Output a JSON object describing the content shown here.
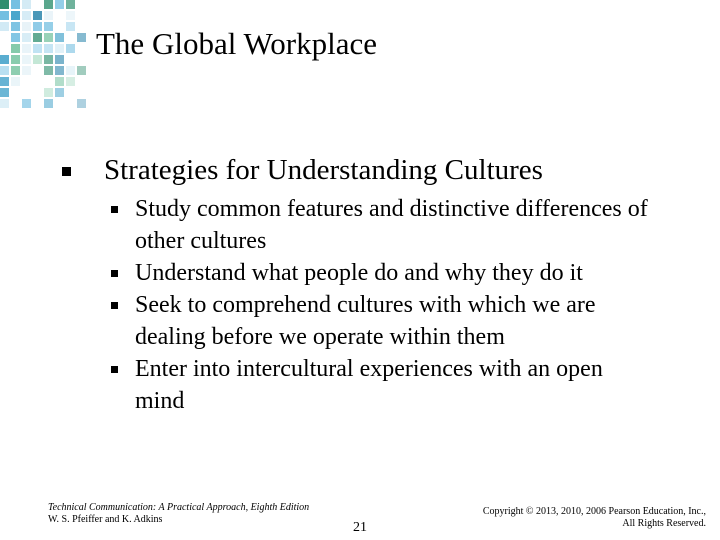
{
  "slide": {
    "title": "The Global Workplace",
    "main_bullet": "Strategies for Understanding Cultures",
    "sub_bullets": [
      "Study common features and distinctive differences of other cultures",
      "Understand what people do and why they do it",
      "Seek to comprehend cultures with which we are dealing before we operate within them",
      "Enter into intercultural experiences with an open mind"
    ]
  },
  "footer": {
    "book_title": "Technical Communication: A Practical Approach, Eighth Edition",
    "authors": "W. S. Pfeiffer and K. Adkins",
    "page_number": "21",
    "copyright_line1": "Copyright © 2013, 2010, 2006 Pearson Education, Inc.,",
    "copyright_line2": "All Rights Reserved."
  },
  "colors": {
    "mosaic": [
      "#1f7fa8",
      "#3d9fc8",
      "#6fbde0",
      "#a8d8ee",
      "#cfe9f4",
      "#2e8f6f",
      "#6cbf9a",
      "#a9dcc4",
      "#e3f1f7"
    ]
  }
}
